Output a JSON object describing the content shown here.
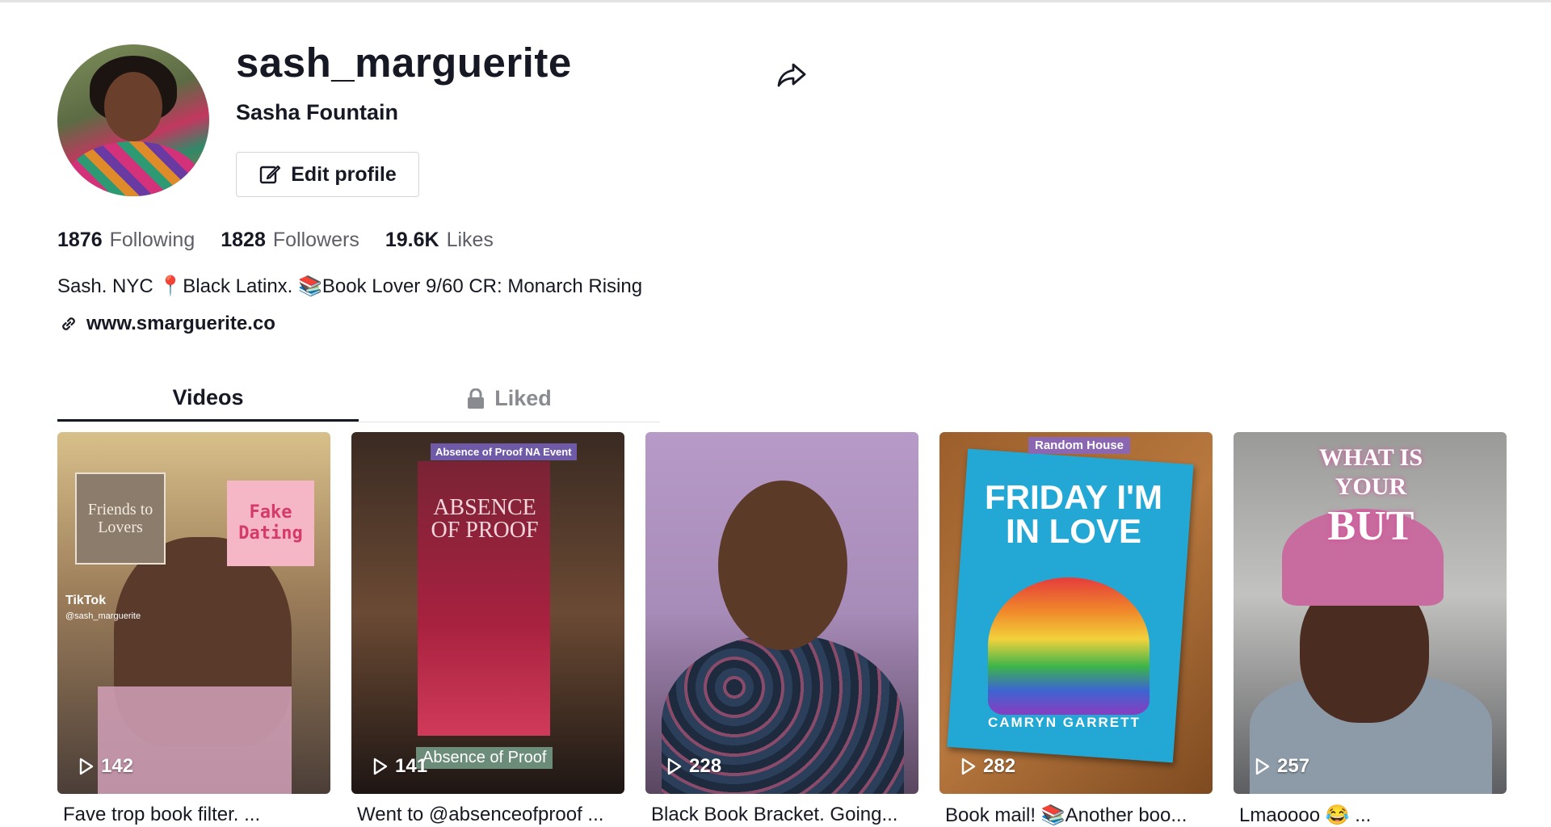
{
  "profile": {
    "username": "sash_marguerite",
    "nickname": "Sasha Fountain",
    "edit_label": "Edit profile",
    "bio": "Sash. NYC 📍Black Latinx. 📚Book Lover 9/60 CR: Monarch Rising",
    "link": "www.smarguerite.co"
  },
  "stats": [
    {
      "value": "1876",
      "label": "Following"
    },
    {
      "value": "1828",
      "label": "Followers"
    },
    {
      "value": "19.6K",
      "label": "Likes"
    }
  ],
  "tabs": [
    {
      "label": "Videos",
      "active": true
    },
    {
      "label": "Liked",
      "active": false
    }
  ],
  "videos": [
    {
      "views": "142",
      "caption": "Fave trop book filter. ...",
      "overlay": {
        "sticker1": "Friends to Lovers",
        "sticker2": "Fake Dating",
        "brand": "TikTok",
        "handle": "@sash_marguerite"
      }
    },
    {
      "views": "141",
      "caption": "Went to @absenceofproof ...",
      "overlay": {
        "tag": "Absence of Proof NA Event",
        "title": "ABSENCE OF PROOF",
        "bottom": "Absence of Proof"
      }
    },
    {
      "views": "228",
      "caption": "Black Book Bracket. Going..."
    },
    {
      "views": "282",
      "caption": "Book mail! 📚Another boo...",
      "overlay": {
        "publisher": "Random House",
        "title": "FRIDAY I'M IN LOVE",
        "author": "CAMRYN GARRETT"
      }
    },
    {
      "views": "257",
      "caption": "Lmaoooo 😂 ...",
      "overlay": {
        "line1": "WHAT IS",
        "line2": "YOUR",
        "line3": "BUT"
      }
    }
  ]
}
